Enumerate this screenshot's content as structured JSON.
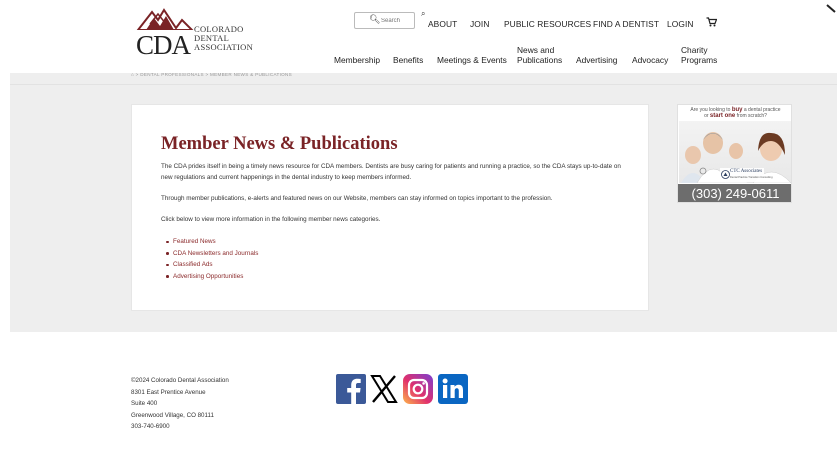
{
  "header": {
    "logo": {
      "letters": "CDA",
      "line1": "COLORADO",
      "line2": "DENTAL",
      "line3": "ASSOCIATION"
    },
    "search": {
      "placeholder": "Search"
    },
    "top_nav": [
      {
        "label": "ABOUT"
      },
      {
        "label": "JOIN"
      },
      {
        "label": "PUBLIC RESOURCES"
      },
      {
        "label": "FIND A DENTIST"
      },
      {
        "label": "LOGIN"
      }
    ],
    "main_nav": [
      {
        "line1": "Membership",
        "line2": ""
      },
      {
        "line1": "Benefits",
        "line2": ""
      },
      {
        "line1": "Meetings & Events",
        "line2": ""
      },
      {
        "line1": "News and",
        "line2": "Publications"
      },
      {
        "line1": "Advertising",
        "line2": ""
      },
      {
        "line1": "Advocacy",
        "line2": ""
      },
      {
        "line1": "Charity",
        "line2": "Programs"
      }
    ]
  },
  "breadcrumb": "> DENTAL PROFESSIONALS  > MEMBER NEWS & PUBLICATIONS",
  "main": {
    "title": "Member News & Publications",
    "paragraphs": [
      "The CDA prides itself in being a timely news resource for CDA members. Dentists are busy caring for patients and running a practice, so the CDA stays up-to-date on new regulations and current happenings in the dental industry to keep members informed.",
      "Through member publications, e-alerts and featured news on our Website, members can stay informed on topics important to the profession.",
      "Click below to view more information in the following member news categories."
    ],
    "links": [
      {
        "label": "Featured News"
      },
      {
        "label": "CDA Newsletters and Journals"
      },
      {
        "label": "Classified Ads"
      },
      {
        "label": "Advertising Opportunities"
      }
    ]
  },
  "ad": {
    "line1_pre": "Are you looking to ",
    "line1_em": "buy",
    "line1_post": " a dental practice",
    "line2_pre": "or ",
    "line2_em": "start one",
    "line2_post": " from scratch?",
    "brand": "CTC Associates",
    "brand_sub": "Dental Practice Transition Consulting",
    "phone": "(303) 249-0611"
  },
  "footer": {
    "lines": [
      "©2024 Colorado Dental Association",
      "8301 East Prentice Avenue",
      "Suite 400",
      "Greenwood Village, CO 80111",
      "303-740-6900"
    ],
    "social": [
      {
        "icon": "facebook-icon",
        "color": "#3b5998"
      },
      {
        "icon": "x-icon",
        "color": "#000000"
      },
      {
        "icon": "instagram-icon",
        "color": "#d6249f"
      },
      {
        "icon": "linkedin-icon",
        "color": "#0a66c2"
      }
    ]
  },
  "colors": {
    "brand_red": "#7a2326",
    "link_red": "#8b2a2b",
    "band_gray": "#eeeeee",
    "phone_bar": "#6d6d6d"
  }
}
